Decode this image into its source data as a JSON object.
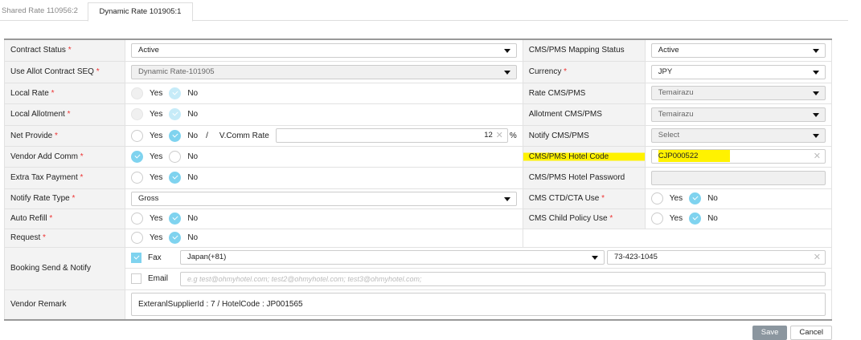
{
  "tabs": [
    {
      "label": "Shared Rate 110956:2"
    },
    {
      "label": "Dynamic Rate 101905:1"
    }
  ],
  "form": {
    "contract_status": {
      "label": "Contract Status",
      "value": "Active"
    },
    "use_allot_seq": {
      "label": "Use Allot Contract SEQ",
      "value": "Dynamic Rate-101905"
    },
    "local_rate": {
      "label": "Local Rate"
    },
    "local_allotment": {
      "label": "Local Allotment"
    },
    "net_provide": {
      "label": "Net Provide",
      "slash": "/",
      "vcomm_label": "V.Comm Rate",
      "vcomm_value": "12",
      "pct": "%"
    },
    "vendor_add_comm": {
      "label": "Vendor Add Comm"
    },
    "extra_tax": {
      "label": "Extra Tax Payment"
    },
    "notify_rate_type": {
      "label": "Notify Rate Type",
      "value": "Gross"
    },
    "auto_refill": {
      "label": "Auto Refill"
    },
    "request": {
      "label": "Request"
    },
    "booking": {
      "label": "Booking Send & Notify",
      "fax_label": "Fax",
      "fax_country": "Japan(+81)",
      "fax_number": "73-423-1045",
      "email_label": "Email",
      "email_placeholder": "e.g test@ohmyhotel.com; test2@ohmyhotel.com; test3@ohmyhotel.com;"
    },
    "vendor_remark": {
      "label": "Vendor Remark",
      "value": "ExteranlSupplierId : 7 / HotelCode : JP001565"
    },
    "cms_mapping_status": {
      "label": "CMS/PMS Mapping Status",
      "value": "Active"
    },
    "currency": {
      "label": "Currency",
      "value": "JPY"
    },
    "rate_cms": {
      "label": "Rate CMS/PMS",
      "value": "Temairazu"
    },
    "allot_cms": {
      "label": "Allotment CMS/PMS",
      "value": "Temairazu"
    },
    "notify_cms": {
      "label": "Notify CMS/PMS",
      "value": "Select"
    },
    "hotel_code": {
      "label": "CMS/PMS Hotel Code",
      "value": "CJP000522"
    },
    "hotel_password": {
      "label": "CMS/PMS Hotel Password",
      "value": ""
    },
    "ctd_cta": {
      "label": "CMS CTD/CTA Use"
    },
    "child_policy": {
      "label": "CMS Child Policy Use"
    }
  },
  "common": {
    "yes": "Yes",
    "no": "No",
    "required": "*"
  },
  "buttons": {
    "save": "Save",
    "cancel": "Cancel"
  },
  "colors": {
    "highlight": "#fff200",
    "check": "#7fd3ef",
    "required": "#e33333"
  }
}
